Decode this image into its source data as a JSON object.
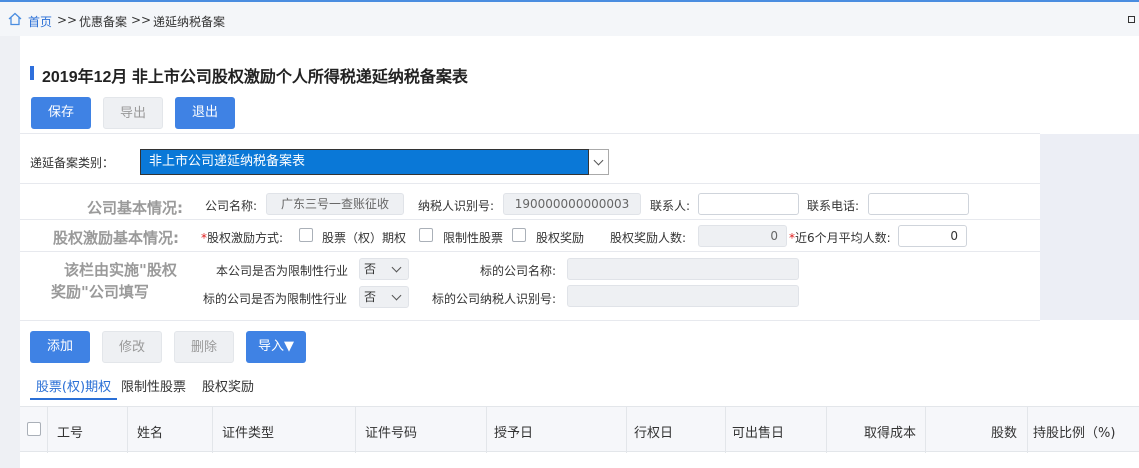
{
  "breadcrumb": {
    "home": "首页",
    "sep1": ">>",
    "item1": "优惠备案",
    "sep2": ">>",
    "item2": "递延纳税备案"
  },
  "title": "2019年12月  非上市公司股权激励个人所得税递延纳税备案表",
  "toolbar": {
    "save": "保存",
    "export": "导出",
    "exit": "退出"
  },
  "category": {
    "label": "递延备案类别：",
    "value": "非上市公司递延纳税备案表"
  },
  "company_basic": {
    "section": "公司基本情况:",
    "name_label": "公司名称:",
    "name_value": "广东三号一查账征收",
    "taxid_label": "纳税人识别号:",
    "taxid_value": "190000000000003",
    "contact_label": "联系人:",
    "contact_value": "",
    "phone_label": "联系电话:",
    "phone_value": ""
  },
  "equity_basic": {
    "section": "股权激励基本情况:",
    "method_label": "股权激励方式:",
    "opt1": "股票（权）期权",
    "opt2": "限制性股票",
    "opt3": "股权奖励",
    "count_label": "股权奖励人数:",
    "count_value": "0",
    "avg_label": "近6个月平均人数:",
    "avg_value": "0"
  },
  "restricted": {
    "section_line1": "该栏由实施\"股权",
    "section_line2": "奖励\"公司填写",
    "own_label": "本公司是否为限制性行业",
    "own_value": "否",
    "target_name_label": "标的公司名称:",
    "target_name_value": "",
    "target_label": "标的公司是否为限制性行业",
    "target_value": "否",
    "target_taxid_label": "标的公司纳税人识别号:",
    "target_taxid_value": ""
  },
  "list_toolbar": {
    "add": "添加",
    "edit": "修改",
    "delete": "删除",
    "import": "导入▼"
  },
  "tabs": [
    "股票(权)期权",
    "限制性股票",
    "股权奖励"
  ],
  "table_headers": [
    "工号",
    "姓名",
    "证件类型",
    "证件号码",
    "授予日",
    "行权日",
    "可出售日",
    "取得成本",
    "股数",
    "持股比例（%)"
  ],
  "colors": {
    "primary": "#3f82e4",
    "selected": "#0a78d7",
    "link": "#2a6fd6"
  }
}
